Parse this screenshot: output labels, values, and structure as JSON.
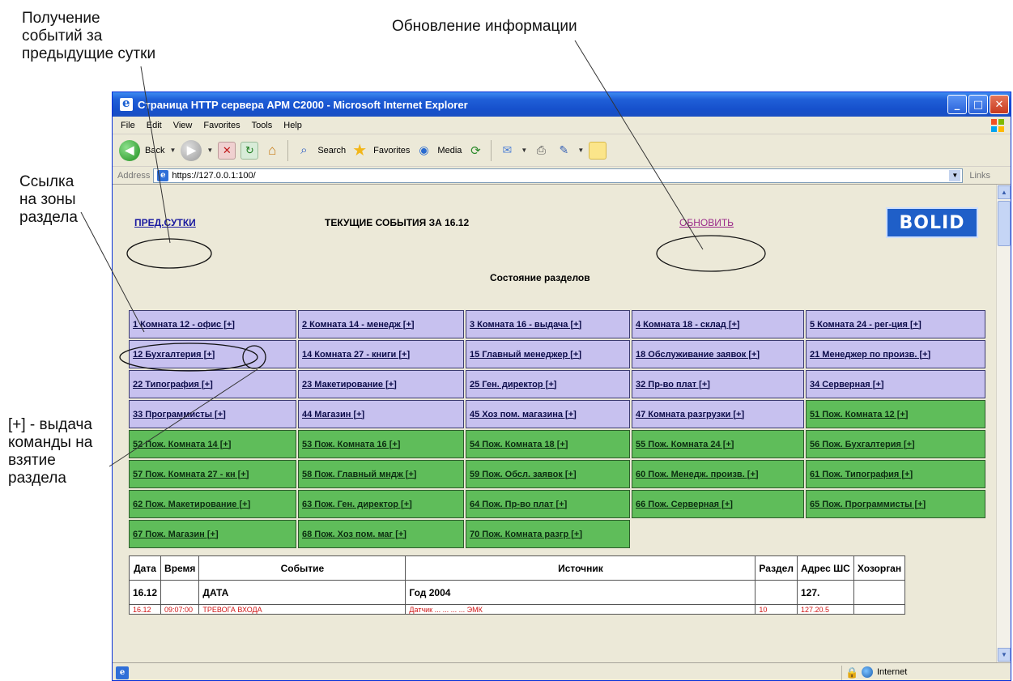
{
  "annotations": {
    "prev_day": [
      "Получение",
      "событий за",
      "предыдущие сутки"
    ],
    "update": "Обновление информации",
    "zones_link": [
      "Ссылка",
      "на зоны",
      "раздела"
    ],
    "arm_command": [
      "[+] - выдача",
      "команды на",
      "взятие",
      "раздела"
    ]
  },
  "window": {
    "title": "Страница HTTP сервера АРМ С2000 - Microsoft Internet Explorer",
    "controls": [
      "_",
      "□",
      "✕"
    ]
  },
  "menu": [
    "File",
    "Edit",
    "View",
    "Favorites",
    "Tools",
    "Help"
  ],
  "toolbar": {
    "back": "Back",
    "search": "Search",
    "favorites": "Favorites",
    "media": "Media"
  },
  "address": {
    "label": "Address",
    "url": "https://127.0.0.1:100/",
    "links": "Links"
  },
  "page": {
    "prev_link": "ПРЕД.СУТКИ",
    "title": "ТЕКУЩИЕ СОБЫТИЯ ЗА 16.12",
    "refresh_link": "ОБНОВИТЬ",
    "logo": "BOLID",
    "section_title": "Состояние разделов"
  },
  "sections": [
    {
      "label": "1 Комната 12 - офис [+]",
      "type": "guard"
    },
    {
      "label": "2 Комната 14 - менедж [+]",
      "type": "guard"
    },
    {
      "label": "3 Комната 16 - выдача [+]",
      "type": "guard"
    },
    {
      "label": "4 Комната 18 - склад [+]",
      "type": "guard"
    },
    {
      "label": "5 Комната 24 - рег-ция [+]",
      "type": "guard"
    },
    {
      "label": "12 Бухгалтерия [+]",
      "type": "guard"
    },
    {
      "label": "14 Комната 27 - книги [+]",
      "type": "guard"
    },
    {
      "label": "15 Главный менеджер [+]",
      "type": "guard"
    },
    {
      "label": "18 Обслуживание заявок [+]",
      "type": "guard"
    },
    {
      "label": "21 Менеджер по произв. [+]",
      "type": "guard"
    },
    {
      "label": "22 Типография [+]",
      "type": "guard"
    },
    {
      "label": "23 Макетирование [+]",
      "type": "guard"
    },
    {
      "label": "25 Ген. директор [+]",
      "type": "guard"
    },
    {
      "label": "32 Пр-во плат [+]",
      "type": "guard"
    },
    {
      "label": "34 Серверная [+]",
      "type": "guard"
    },
    {
      "label": "33 Программисты [+]",
      "type": "guard"
    },
    {
      "label": "44 Магазин [+]",
      "type": "guard"
    },
    {
      "label": "45 Хоз пом. магазина [+]",
      "type": "guard"
    },
    {
      "label": "47 Комната разгрузки [+]",
      "type": "guard"
    },
    {
      "label": "51 Пож. Комната 12 [+]",
      "type": "fire"
    },
    {
      "label": "52 Пож. Комната 14 [+]",
      "type": "fire"
    },
    {
      "label": "53 Пож. Комната 16 [+]",
      "type": "fire"
    },
    {
      "label": "54 Пож. Комната 18 [+]",
      "type": "fire"
    },
    {
      "label": "55 Пож. Комната 24 [+]",
      "type": "fire"
    },
    {
      "label": "56 Пож. Бухгалтерия [+]",
      "type": "fire"
    },
    {
      "label": "57 Пож. Комната 27 - кн [+]",
      "type": "fire"
    },
    {
      "label": "58 Пож. Главный мндж [+]",
      "type": "fire"
    },
    {
      "label": "59 Пож. Обсл. заявок [+]",
      "type": "fire"
    },
    {
      "label": "60 Пож. Менедж. произв. [+]",
      "type": "fire"
    },
    {
      "label": "61 Пож. Типография [+]",
      "type": "fire"
    },
    {
      "label": "62 Пож. Макетирование [+]",
      "type": "fire"
    },
    {
      "label": "63 Пож. Ген. директор [+]",
      "type": "fire"
    },
    {
      "label": "64 Пож. Пр-во плат [+]",
      "type": "fire"
    },
    {
      "label": "66 Пож. Серверная [+]",
      "type": "fire"
    },
    {
      "label": "65 Пож. Программисты [+]",
      "type": "fire"
    },
    {
      "label": "67 Пож. Магазин [+]",
      "type": "fire"
    },
    {
      "label": "68 Пож. Хоз пом. маг [+]",
      "type": "fire"
    },
    {
      "label": "70 Пож. Комната разгр [+]",
      "type": "fire"
    }
  ],
  "events": {
    "headers": [
      "Дата",
      "Время",
      "Событие",
      "Источник",
      "Раздел",
      "Адрес ШС",
      "Хозорган"
    ],
    "rows": [
      {
        "cells": [
          "16.12",
          "",
          "ДАТА",
          "Год 2004",
          "",
          "127.",
          ""
        ],
        "style": "data"
      },
      {
        "cells": [
          "16.12",
          "09:07:00",
          "ТРЕВОГА ВХОДА",
          "Датчик ... ... ... ... ЭМК",
          "10",
          "127.20.5",
          ""
        ],
        "style": "alarm"
      }
    ]
  },
  "status": {
    "zone": "Internet"
  }
}
